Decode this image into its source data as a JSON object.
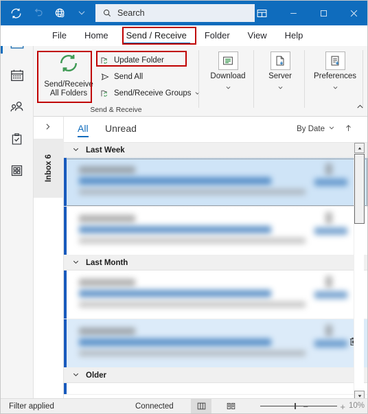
{
  "titlebar": {
    "icons": [
      {
        "name": "sync-icon",
        "title": "Send/Receive All Folders"
      },
      {
        "name": "undo-icon",
        "title": "Undo"
      },
      {
        "name": "globe-icon",
        "title": "Web"
      },
      {
        "name": "chevron-down-icon",
        "title": "Customize Quick Access Toolbar"
      }
    ],
    "search_placeholder": "Search",
    "search_value": "",
    "ribbon_display_title": "Ribbon Display Options",
    "minimize_title": "Minimize",
    "maximize_title": "Restore Down",
    "close_title": "Close"
  },
  "rail": [
    {
      "name": "mail",
      "icon": "mail-icon",
      "active": true
    },
    {
      "name": "calendar",
      "icon": "calendar-icon",
      "active": false
    },
    {
      "name": "people",
      "icon": "people-icon",
      "active": false
    },
    {
      "name": "tasks",
      "icon": "tasks-icon",
      "active": false
    },
    {
      "name": "more-apps",
      "icon": "grid-apps-icon",
      "active": false
    }
  ],
  "tabs": [
    {
      "label": "File",
      "selected": false
    },
    {
      "label": "Home",
      "selected": false
    },
    {
      "label": "Send / Receive",
      "selected": true,
      "highlighted": true
    },
    {
      "label": "Folder",
      "selected": false
    },
    {
      "label": "View",
      "selected": false
    },
    {
      "label": "Help",
      "selected": false
    }
  ],
  "ribbon": {
    "group_label": "Send & Receive",
    "send_receive_all": {
      "line1": "Send/Receive",
      "line2": "All Folders",
      "icon": "refresh-circular-icon",
      "highlighted": true
    },
    "small_commands": [
      {
        "label": "Update Folder",
        "icon": "update-folder-icon",
        "highlighted": true,
        "has_chevron": false
      },
      {
        "label": "Send All",
        "icon": "send-all-icon",
        "highlighted": false,
        "has_chevron": false
      },
      {
        "label": "Send/Receive Groups",
        "icon": "send-receive-groups-icon",
        "highlighted": false,
        "has_chevron": true
      }
    ],
    "buttons": [
      {
        "label": "Download",
        "icon": "download-headers-icon",
        "has_chevron": true
      },
      {
        "label": "Server",
        "icon": "server-icon",
        "has_chevron": true
      },
      {
        "label": "Preferences",
        "icon": "preferences-icon",
        "has_chevron": true
      }
    ],
    "collapse_title": "Collapse the Ribbon",
    "highlight_color": "#c00000"
  },
  "folder_pane": {
    "expand_title": "Expand the Folder Pane",
    "inbox_label": "Inbox 6"
  },
  "list_header": {
    "filter_all": "All",
    "filter_unread": "Unread",
    "sort_by": "By Date",
    "sort_direction_title": "Sort ascending"
  },
  "message_list": {
    "groups": [
      {
        "label": "Last Week",
        "messages": [
          {
            "selected": true,
            "has_attachment": true
          },
          {
            "selected": false,
            "has_attachment": true
          }
        ]
      },
      {
        "label": "Last Month",
        "messages": [
          {
            "selected": false,
            "has_attachment": true
          },
          {
            "selected": true,
            "has_attachment": true,
            "show_delete": true
          }
        ]
      },
      {
        "label": "Older",
        "messages": []
      }
    ],
    "delete_title": "Delete"
  },
  "status_bar": {
    "filter_text": "Filter applied",
    "connection_text": "Connected",
    "view_normal_title": "Normal",
    "view_reading_title": "Reading View",
    "zoom_out_label": "−",
    "zoom_in_label": "+",
    "zoom_level": "10%"
  },
  "colors": {
    "titlebar": "#0f6cbd",
    "accent": "#0f6cbd",
    "highlight": "#c00000",
    "selection": "#cfe4f7",
    "ribbon_bg": "#f5f5f5"
  }
}
